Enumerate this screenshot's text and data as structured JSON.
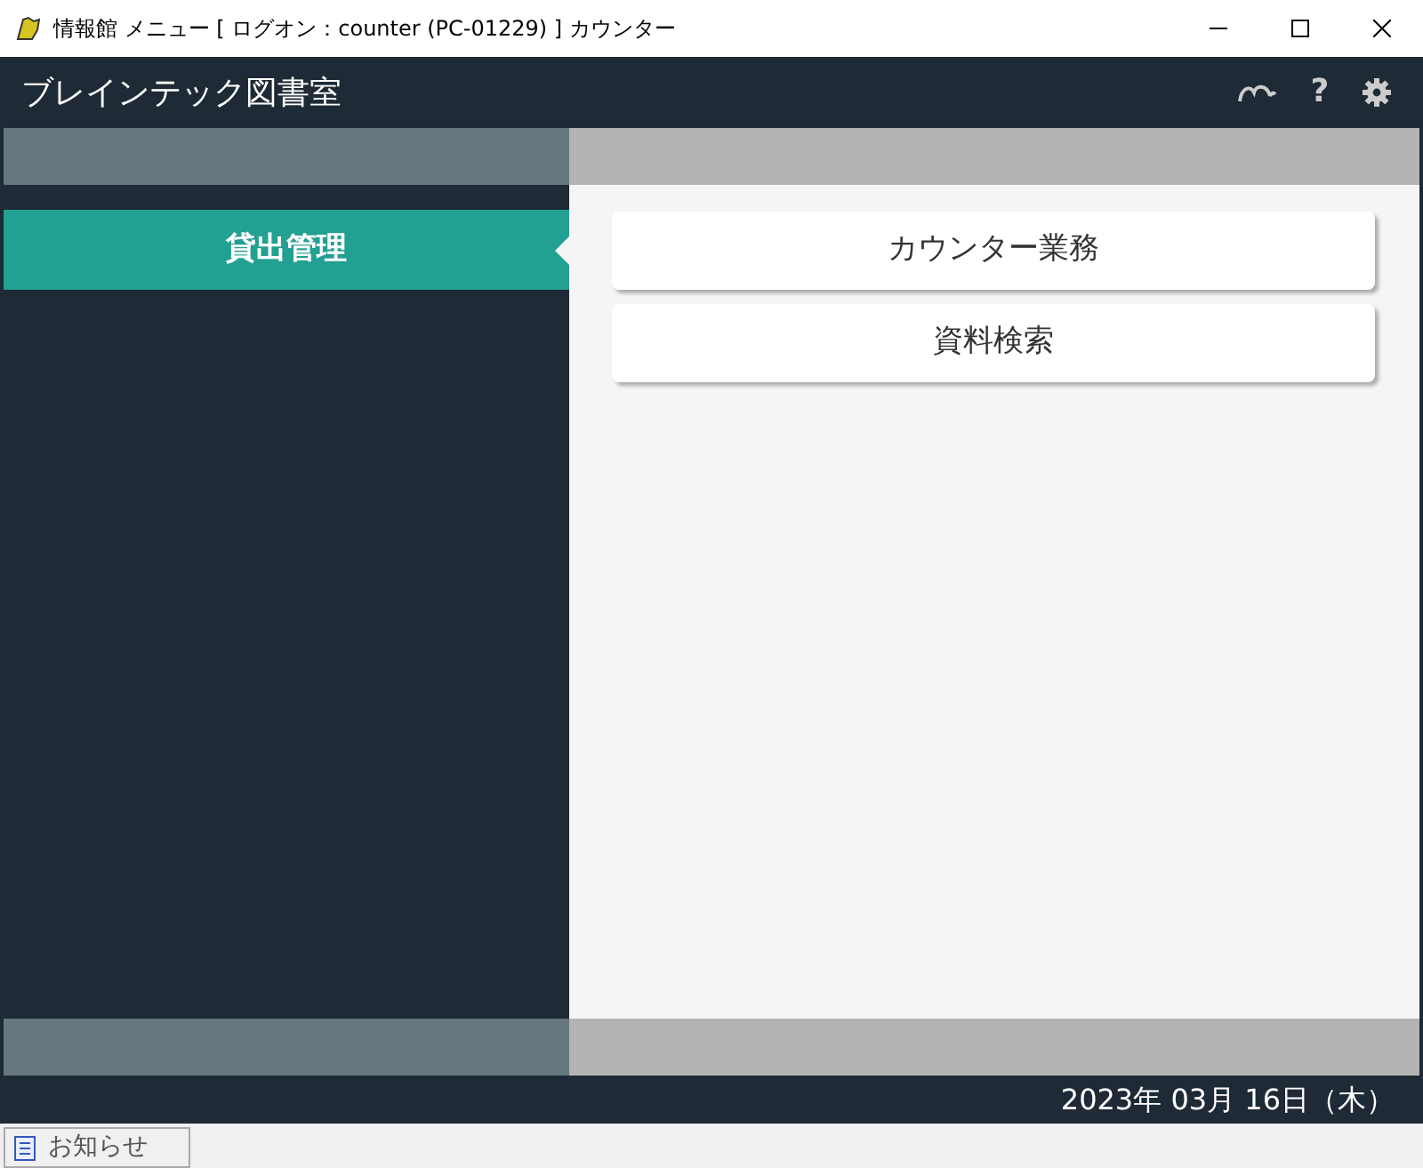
{
  "window": {
    "title": "情報館 メニュー [ ログオン：counter (PC-01229) ] カウンター"
  },
  "app_bar": {
    "title": "ブレインテック図書室",
    "help_label": "?"
  },
  "sidebar": {
    "items": [
      {
        "label": "貸出管理",
        "selected": true
      }
    ]
  },
  "menu_buttons": [
    {
      "label": "カウンター業務"
    },
    {
      "label": "資料検索"
    }
  ],
  "status_bar": {
    "date": "2023年 03月 16日（木）"
  },
  "notice_tab": {
    "label": "お知らせ"
  }
}
